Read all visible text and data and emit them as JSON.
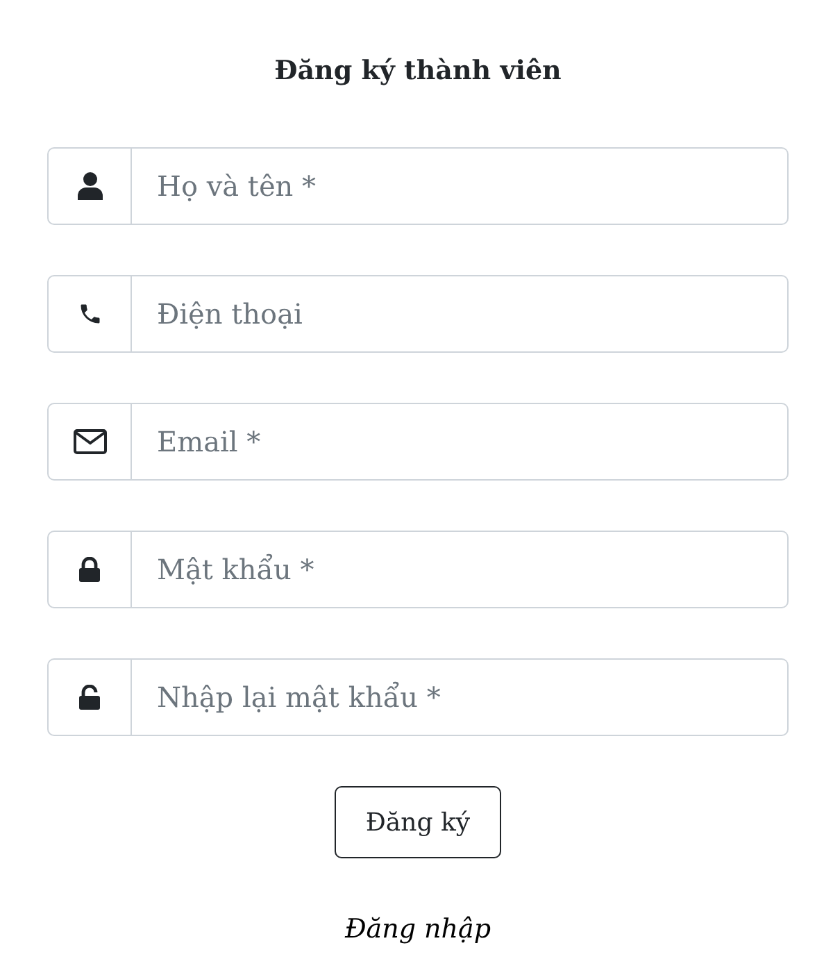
{
  "title": "Đăng ký thành viên",
  "fields": [
    {
      "kind": "user",
      "placeholder": "Họ và tên *"
    },
    {
      "kind": "phone",
      "placeholder": "Điện thoại"
    },
    {
      "kind": "email",
      "placeholder": "Email *"
    },
    {
      "kind": "lock",
      "placeholder": "Mật khẩu *"
    },
    {
      "kind": "unlock",
      "placeholder": "Nhập lại mật khẩu *"
    }
  ],
  "submit": "Đăng ký",
  "login_link": "Đăng nhập"
}
